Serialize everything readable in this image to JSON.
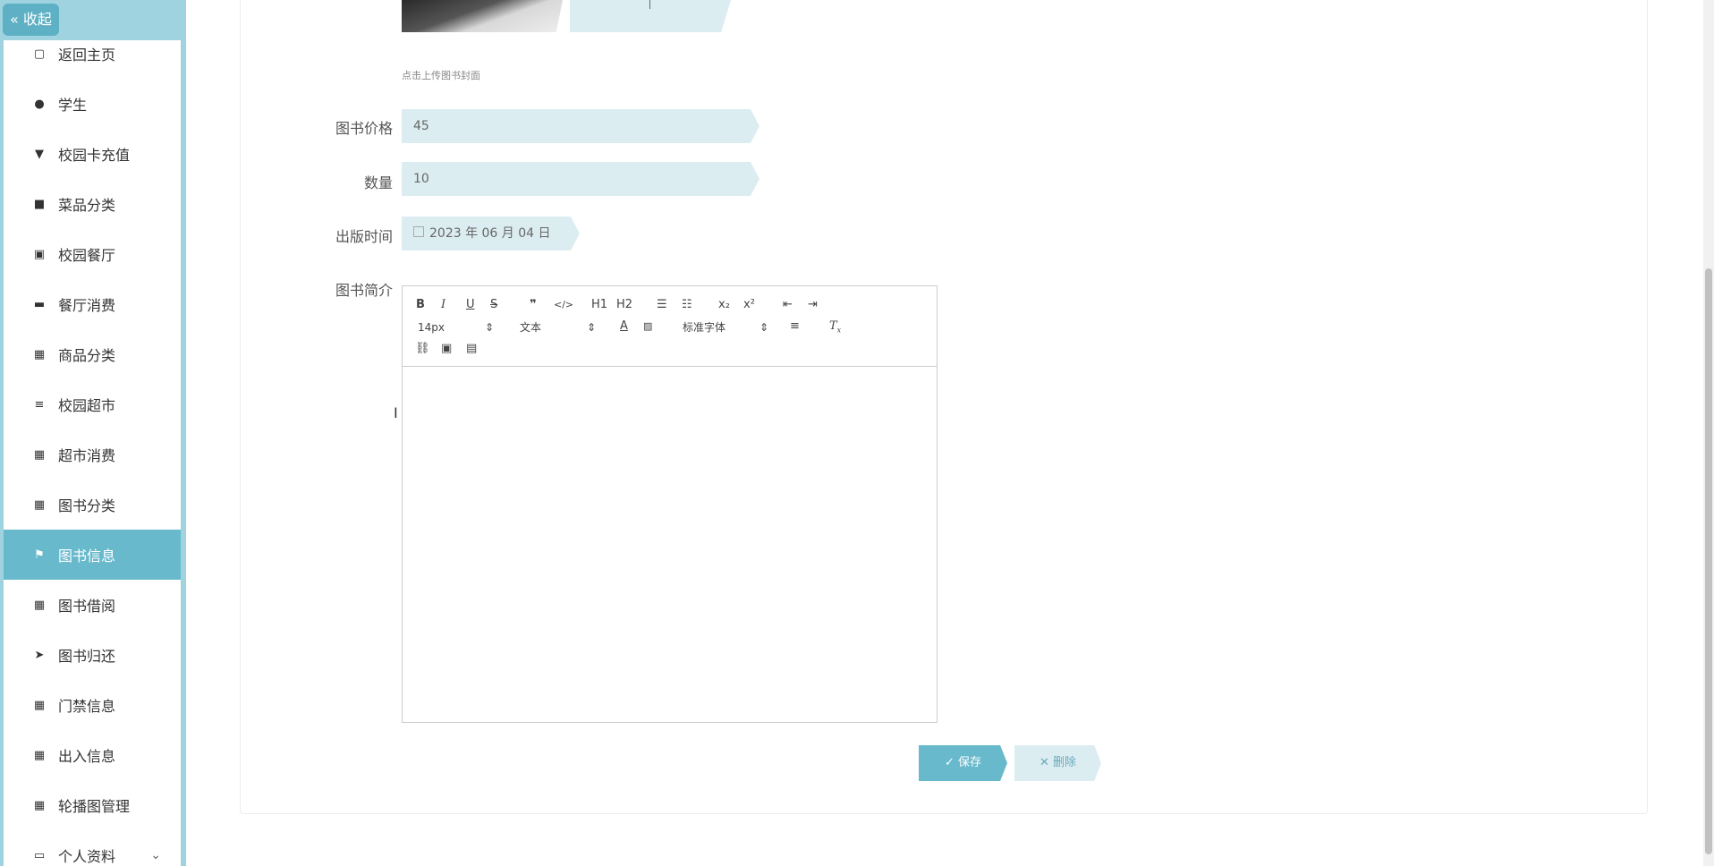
{
  "sidebar": {
    "collapse_label": "« 收起",
    "items": [
      {
        "label": "返回主页",
        "icon": "home-icon",
        "glyph": "▢"
      },
      {
        "label": "学生",
        "icon": "user-icon",
        "glyph": "●"
      },
      {
        "label": "校园卡充值",
        "icon": "paint-roller-icon",
        "glyph": "▼"
      },
      {
        "label": "菜品分类",
        "icon": "comment-icon",
        "glyph": "■"
      },
      {
        "label": "校园餐厅",
        "icon": "clipboard-icon",
        "glyph": "▣"
      },
      {
        "label": "餐厅消费",
        "icon": "monitor-icon",
        "glyph": "▬"
      },
      {
        "label": "商品分类",
        "icon": "grid-icon",
        "glyph": "▦"
      },
      {
        "label": "校园超市",
        "icon": "list-icon",
        "glyph": "≡"
      },
      {
        "label": "超市消费",
        "icon": "grid-icon",
        "glyph": "▦"
      },
      {
        "label": "图书分类",
        "icon": "grid-icon",
        "glyph": "▦"
      },
      {
        "label": "图书信息",
        "icon": "flag-icon",
        "glyph": "⚑"
      },
      {
        "label": "图书借阅",
        "icon": "grid-icon",
        "glyph": "▦"
      },
      {
        "label": "图书归还",
        "icon": "send-icon",
        "glyph": "➤"
      },
      {
        "label": "门禁信息",
        "icon": "grid-icon",
        "glyph": "▦"
      },
      {
        "label": "出入信息",
        "icon": "grid-icon",
        "glyph": "▦"
      },
      {
        "label": "轮播图管理",
        "icon": "grid-icon",
        "glyph": "▦"
      },
      {
        "label": "个人资料",
        "icon": "profile-icon",
        "glyph": "▭"
      }
    ],
    "active_index": 10
  },
  "form": {
    "upload_hint": "点击上传图书封面",
    "price_label": "图书价格",
    "price_value": "45",
    "qty_label": "数量",
    "qty_value": "10",
    "date_label": "出版时间",
    "date_value": "2023 年 06 月 04 日",
    "intro_label": "图书简介",
    "editor": {
      "font_size": "14px",
      "block_format": "文本",
      "font_family": "标准字体",
      "h1": "H1",
      "h2": "H2"
    },
    "save_label": "保存",
    "delete_label": "删除"
  }
}
